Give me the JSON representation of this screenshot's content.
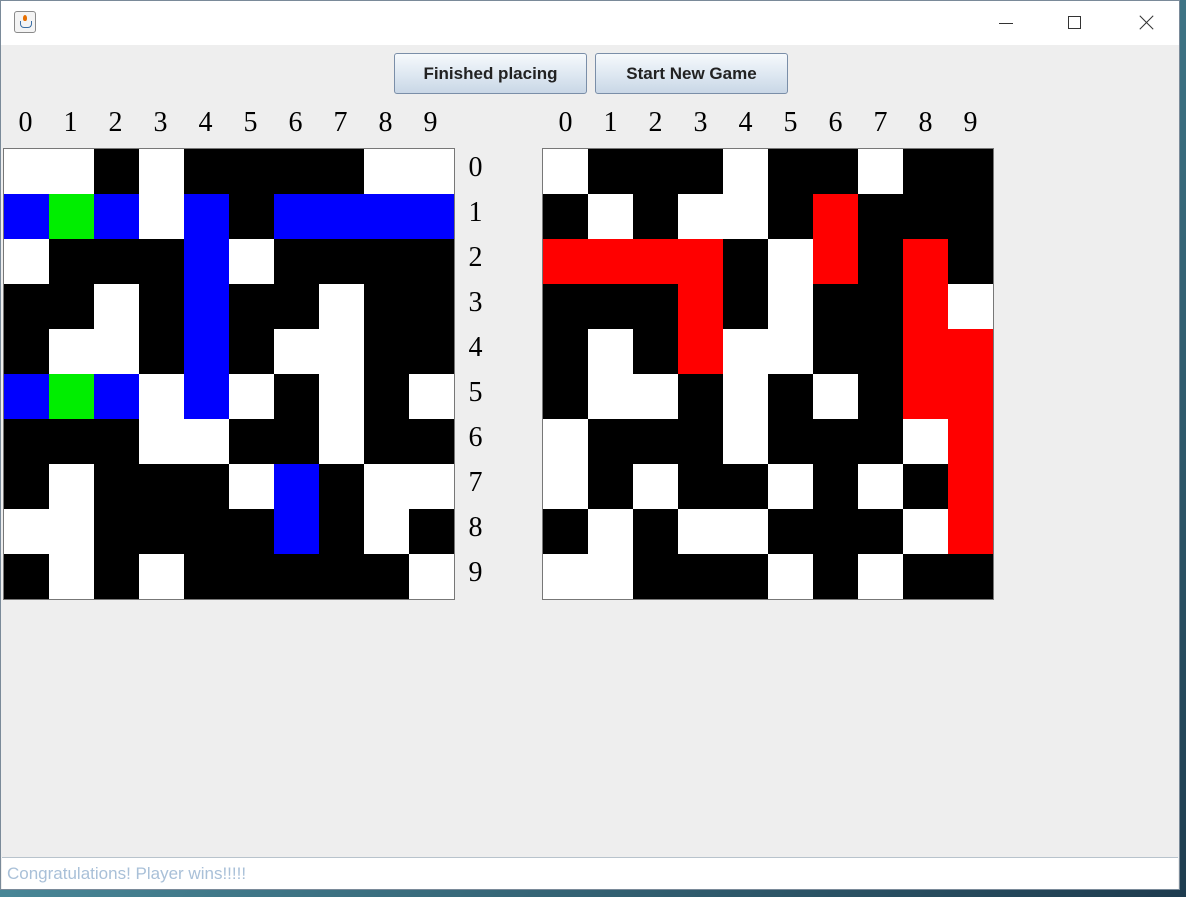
{
  "window": {
    "title": "",
    "icon": "java-cup-icon",
    "controls": [
      "minimize-icon",
      "maximize-icon",
      "close-icon"
    ]
  },
  "toolbar": {
    "finished_label": "Finished placing",
    "new_game_label": "Start New Game"
  },
  "column_labels": [
    "0",
    "1",
    "2",
    "3",
    "4",
    "5",
    "6",
    "7",
    "8",
    "9"
  ],
  "row_labels": [
    "0",
    "1",
    "2",
    "3",
    "4",
    "5",
    "6",
    "7",
    "8",
    "9"
  ],
  "colors": {
    "W": "#ffffff",
    "K": "#000000",
    "B": "#0000ff",
    "G": "#00ee00",
    "R": "#ff0000"
  },
  "player_board": [
    "WWKWKKKKWW",
    "BGBWBKBBBB",
    "WKKKBWKKKK",
    "KKWKBKKWKK",
    "KWWKBKWWKK",
    "BGBWBWKWKW",
    "KKKWWKKWKK",
    "KWKKKWBKWW",
    "WWKKKKBKWK",
    "KWKWKKKKKW"
  ],
  "opponent_board": [
    "WKKKWKKWKK",
    "KWKWWKRKKK",
    "RRRRKWRKRK",
    "KKKRKWKKRW",
    "KWKRWWKKRR",
    "KWWKWKWKRR",
    "WKKKWKKKWR",
    "WKWKKWKWKR",
    "KWKWWKKKWR",
    "WWKKKWKWKK"
  ],
  "status": {
    "message": "Congratulations! Player wins!!!!!"
  }
}
